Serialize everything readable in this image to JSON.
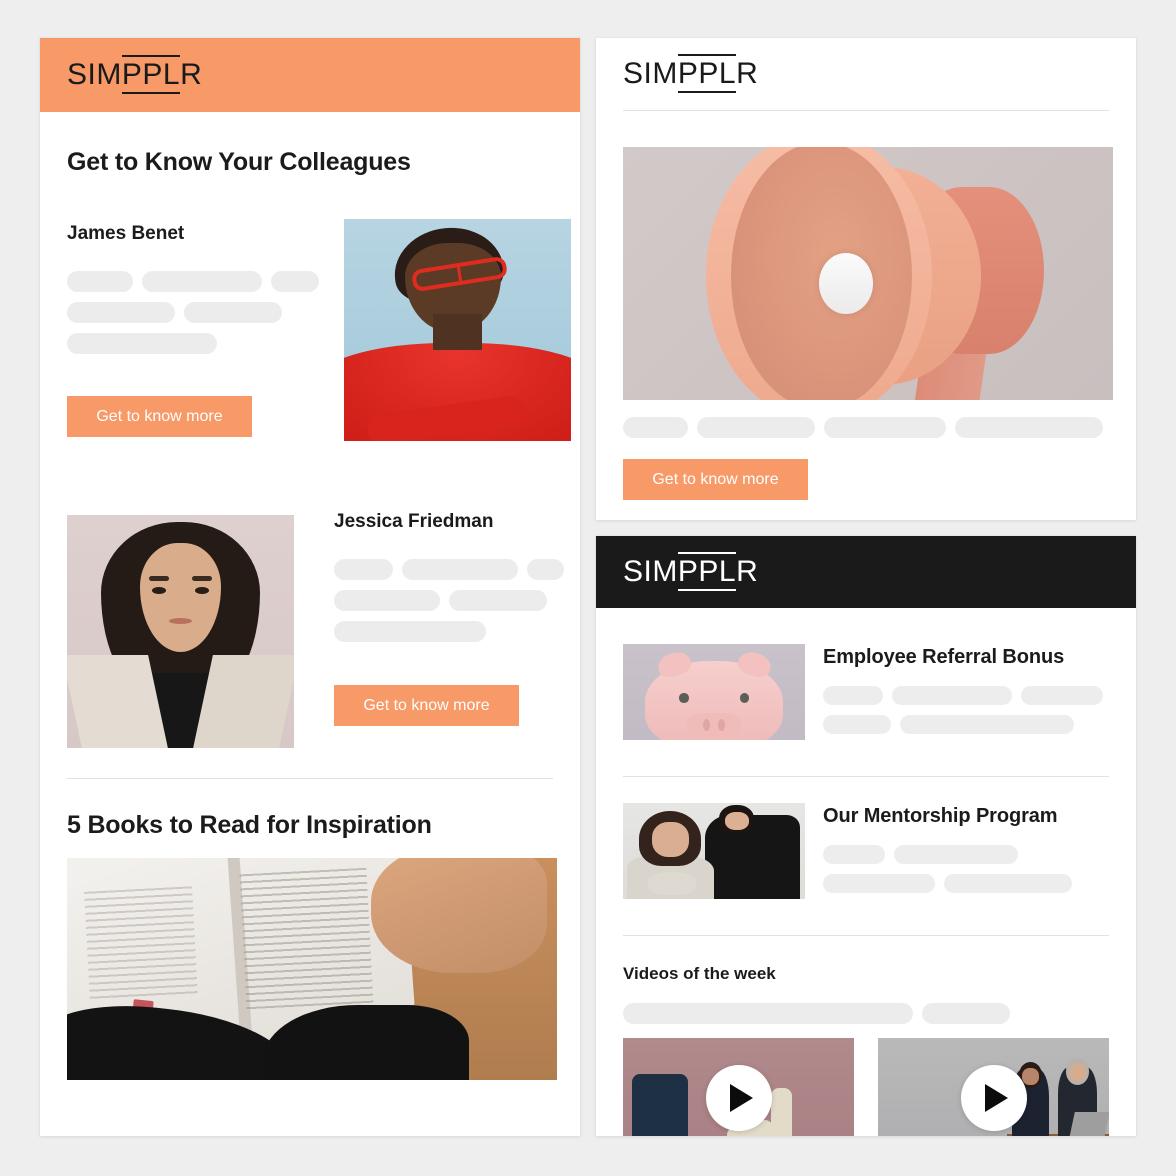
{
  "brand": {
    "name_part1": "SIM",
    "name_mark": "PPL",
    "name_part3": "R",
    "orange": "#F89A68",
    "black": "#1a1a1a",
    "page_background": "#efeeee"
  },
  "left_card": {
    "logo_variant": "orange-header",
    "section_title": "Get to Know Your Colleagues",
    "people": [
      {
        "name": "James Benet",
        "cta_label": "Get to know more",
        "photo": "portrait-man-red-sweater-glasses",
        "skeleton_rows": [
          [
            78,
            120,
            48
          ],
          [
            108,
            98
          ],
          [
            148
          ]
        ]
      },
      {
        "name": "Jessica Friedman",
        "cta_label": "Get to know more",
        "photo": "portrait-woman-dark-hair-blazer",
        "skeleton_rows": [
          [
            63,
            124,
            40
          ],
          [
            106,
            98
          ],
          [
            152
          ]
        ]
      }
    ],
    "books_title": "5 Books to Read for Inspiration",
    "books_photo": "open-book-hands-wooden-table"
  },
  "top_right_card": {
    "logo_variant": "white-header",
    "hero_photo": "3d-megaphone-illustration",
    "skeleton_row": [
      65,
      118,
      122,
      148
    ],
    "cta_label": "Get to know more"
  },
  "bottom_right_card": {
    "logo_variant": "black-header",
    "items": [
      {
        "title": "Employee Referral Bonus",
        "photo": "piggy-bank-pink",
        "skeleton_rows": [
          [
            62,
            120,
            80
          ],
          [
            70,
            174
          ]
        ]
      },
      {
        "title": "Our Mentorship Program",
        "photo": "two-colleagues-meeting",
        "skeleton_rows": [
          [
            62,
            124
          ],
          [
            114,
            128
          ]
        ]
      }
    ],
    "videos_section": {
      "title": "Videos of the week",
      "skeleton_row": [
        292,
        88
      ],
      "videos": [
        {
          "thumbnail": "wooden-blocks-pink-background",
          "play_icon": "play-icon"
        },
        {
          "thumbnail": "two-people-meeting-laptop",
          "play_icon": "play-icon"
        }
      ]
    }
  }
}
